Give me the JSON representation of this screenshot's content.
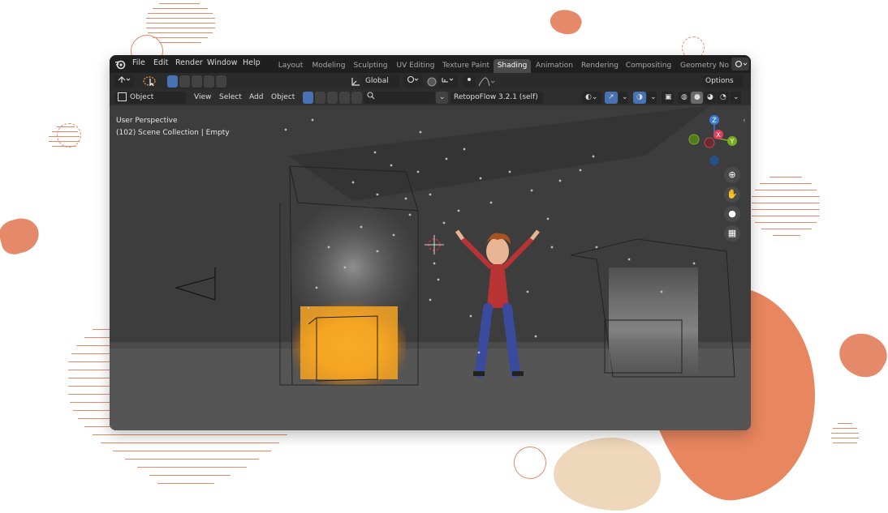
{
  "menu": {
    "file": "File",
    "edit": "Edit",
    "render": "Render",
    "window": "Window",
    "help": "Help"
  },
  "workspaces": [
    "Layout",
    "Modeling",
    "Sculpting",
    "UV Editing",
    "Texture Paint",
    "Shading",
    "Animation",
    "Rendering",
    "Compositing",
    "Geometry No"
  ],
  "active_workspace": "Shading",
  "toolbar": {
    "transform_orientation": "Global",
    "options_label": "Options"
  },
  "header": {
    "mode": "Object Mode",
    "view": "View",
    "select": "Select",
    "add": "Add",
    "object": "Object",
    "addon": "RetopoFlow 3.2.1 (self)"
  },
  "viewport": {
    "perspective": "User Perspective",
    "collection": "(102) Scene Collection | Empty"
  },
  "gizmo": {
    "z": "Z",
    "y": "Y",
    "x": "X"
  },
  "colors": {
    "accent": "#e48a6a",
    "active_blue": "#4772b3",
    "fire": "#f3a21c"
  }
}
